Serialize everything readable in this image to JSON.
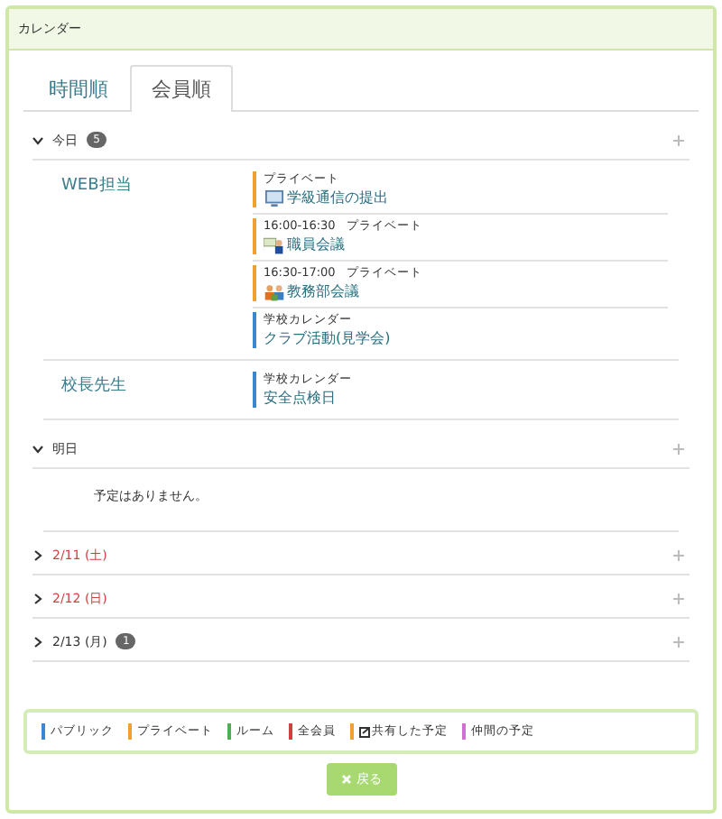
{
  "panel": {
    "title": "カレンダー"
  },
  "tabs": [
    {
      "label": "時間順",
      "selected": false
    },
    {
      "label": "会員順",
      "selected": true
    }
  ],
  "days": [
    {
      "label": "今日",
      "expanded": true,
      "holiday": false,
      "badge": "5",
      "members": [
        {
          "name": "WEB担当",
          "events": [
            {
              "calendar": "プライベート",
              "title": "学級通信の提出",
              "color": "#f0a030",
              "kind": "monitor"
            },
            {
              "time": "16:00-16:30",
              "calendar": "プライベート",
              "title": "職員会議",
              "color": "#f0a030",
              "kind": "meeting"
            },
            {
              "time": "16:30-17:00",
              "calendar": "プライベート",
              "title": "教務部会議",
              "color": "#f0a030",
              "kind": "group"
            },
            {
              "calendar": "学校カレンダー",
              "title": "クラブ活動(見学会)",
              "color": "#3a86d0"
            }
          ]
        },
        {
          "name": "校長先生",
          "events": [
            {
              "calendar": "学校カレンダー",
              "title": "安全点検日",
              "color": "#3a86d0"
            }
          ]
        }
      ]
    },
    {
      "label": "明日",
      "expanded": true,
      "holiday": false,
      "empty": "予定はありません。"
    },
    {
      "label": "2/11 (土)",
      "expanded": false,
      "holiday": true
    },
    {
      "label": "2/12 (日)",
      "expanded": false,
      "holiday": true
    },
    {
      "label": "2/13 (月)",
      "expanded": false,
      "holiday": false,
      "badge": "1"
    }
  ],
  "legend": [
    {
      "label": "パブリック",
      "color": "#3a86d0"
    },
    {
      "label": "プライベート",
      "color": "#f0a030"
    },
    {
      "label": "ルーム",
      "color": "#4caf50"
    },
    {
      "label": "全会員",
      "color": "#d04040"
    },
    {
      "label": "共有した予定",
      "color": "#f0a030",
      "kind": "shared"
    },
    {
      "label": "仲間の予定",
      "color": "#d070d0"
    }
  ],
  "back_button": {
    "label": "戻る"
  }
}
